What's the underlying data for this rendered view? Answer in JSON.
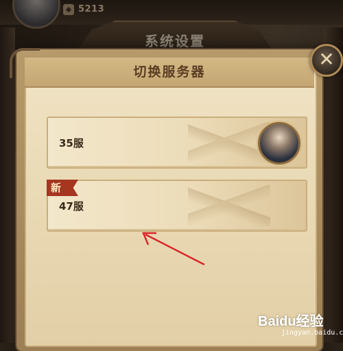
{
  "topbar": {
    "currency_icon": "currency-icon",
    "currency_value": "5213"
  },
  "dialog": {
    "outer_title": "系统设置",
    "title": "切换服务器",
    "close_icon": "close-icon"
  },
  "servers": [
    {
      "label": "35服",
      "badge": "",
      "has_avatar": true
    },
    {
      "label": "47服",
      "badge": "新",
      "has_avatar": false
    }
  ],
  "watermark": {
    "logo": "Baidu经验",
    "url": "jingyan.baidu.com"
  },
  "annotation": {
    "type": "red-arrow",
    "points_to": "server-47"
  },
  "colors": {
    "parchment": "#ecdcb8",
    "title_text": "#5a3d22",
    "new_badge": "#a5361f",
    "annotation_arrow": "#d8262a"
  }
}
